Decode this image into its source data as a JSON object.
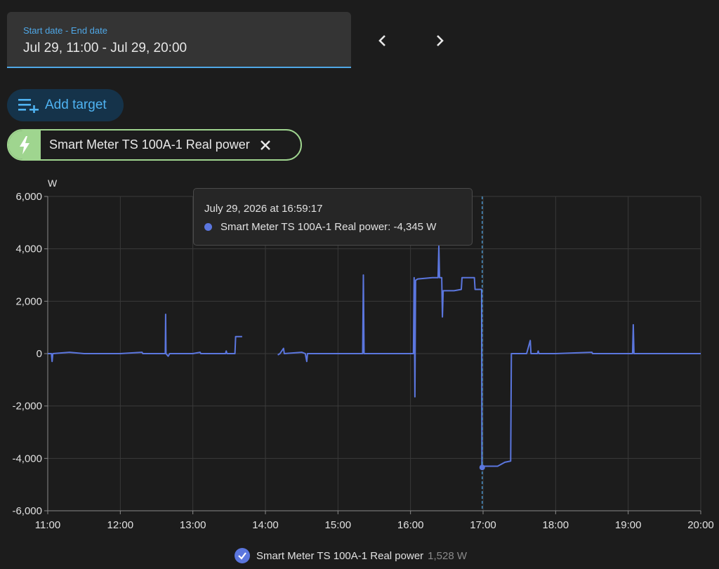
{
  "date_range": {
    "label": "Start date - End date",
    "value": "Jul 29, 11:00 - Jul 29, 20:00"
  },
  "nav": {
    "prev_icon": "chevron-left-icon",
    "next_icon": "chevron-right-icon"
  },
  "add_target": {
    "label": "Add target",
    "icon": "playlist-add-icon"
  },
  "target_chip": {
    "label": "Smart Meter TS 100A-1 Real power",
    "icon": "flash-icon",
    "close_icon": "close-icon"
  },
  "tooltip": {
    "date": "July 29, 2026 at 16:59:17",
    "text": "Smart Meter TS 100A-1 Real power: -4,345 W"
  },
  "legend": {
    "name": "Smart Meter TS 100A-1 Real power",
    "value": "1,528 W"
  },
  "colors": {
    "series": "#5b76de",
    "accent": "#4fa7e6",
    "chip": "#9fd58f"
  },
  "chart_data": {
    "type": "line",
    "ylabel": "W",
    "ylim": [
      -6000,
      6000
    ],
    "yticks": [
      "6,000",
      "4,000",
      "2,000",
      "0",
      "-2,000",
      "-4,000",
      "-6,000"
    ],
    "ytick_values": [
      6000,
      4000,
      2000,
      0,
      -2000,
      -4000,
      -6000
    ],
    "xlim": [
      11,
      20
    ],
    "xticks": [
      "11:00",
      "12:00",
      "13:00",
      "14:00",
      "15:00",
      "16:00",
      "17:00",
      "18:00",
      "19:00",
      "20:00"
    ],
    "xtick_values": [
      11,
      12,
      13,
      14,
      15,
      16,
      17,
      18,
      19,
      20
    ],
    "grid": true,
    "cursor_x": 16.988,
    "cursor_y": -4345,
    "series": [
      {
        "name": "Smart Meter TS 100A-1 Real power",
        "segments": [
          [
            [
              11.0,
              0
            ],
            [
              11.05,
              0
            ],
            [
              11.06,
              -300
            ],
            [
              11.07,
              0
            ],
            [
              11.3,
              50
            ],
            [
              11.5,
              0
            ],
            [
              12.0,
              0
            ],
            [
              12.3,
              50
            ],
            [
              12.31,
              0
            ],
            [
              12.62,
              0
            ],
            [
              12.625,
              1500
            ],
            [
              12.63,
              0
            ],
            [
              12.66,
              -100
            ],
            [
              12.68,
              0
            ],
            [
              13.0,
              0
            ],
            [
              13.1,
              50
            ],
            [
              13.11,
              0
            ],
            [
              13.45,
              0
            ],
            [
              13.46,
              100
            ],
            [
              13.47,
              0
            ],
            [
              13.58,
              0
            ],
            [
              13.59,
              650
            ],
            [
              13.68,
              650
            ]
          ],
          [
            [
              14.17,
              -50
            ],
            [
              14.2,
              0
            ],
            [
              14.25,
              200
            ],
            [
              14.26,
              0
            ],
            [
              14.5,
              50
            ],
            [
              14.55,
              0
            ],
            [
              14.57,
              -300
            ],
            [
              14.58,
              0
            ],
            [
              15.0,
              0
            ],
            [
              15.34,
              0
            ],
            [
              15.35,
              3000
            ],
            [
              15.36,
              0
            ],
            [
              15.6,
              0
            ],
            [
              16.0,
              0
            ],
            [
              16.04,
              0
            ],
            [
              16.05,
              2900
            ],
            [
              16.06,
              -1650
            ],
            [
              16.07,
              2800
            ],
            [
              16.1,
              2850
            ],
            [
              16.3,
              2900
            ],
            [
              16.38,
              2900
            ],
            [
              16.39,
              4100
            ],
            [
              16.4,
              2900
            ],
            [
              16.43,
              2900
            ],
            [
              16.44,
              1400
            ],
            [
              16.45,
              2400
            ],
            [
              16.6,
              2400
            ],
            [
              16.7,
              2450
            ],
            [
              16.71,
              2900
            ],
            [
              16.88,
              2900
            ],
            [
              16.89,
              2450
            ],
            [
              16.98,
              2450
            ],
            [
              16.985,
              -4345
            ],
            [
              17.0,
              -4300
            ],
            [
              17.2,
              -4300
            ],
            [
              17.3,
              -4150
            ],
            [
              17.38,
              -4100
            ],
            [
              17.39,
              0
            ],
            [
              17.6,
              0
            ],
            [
              17.65,
              500
            ],
            [
              17.66,
              0
            ],
            [
              17.75,
              0
            ],
            [
              17.76,
              100
            ],
            [
              17.77,
              0
            ],
            [
              18.0,
              0
            ],
            [
              18.5,
              50
            ],
            [
              18.51,
              0
            ],
            [
              19.0,
              0
            ],
            [
              19.06,
              0
            ],
            [
              19.07,
              1100
            ],
            [
              19.08,
              0
            ],
            [
              19.5,
              0
            ],
            [
              20.0,
              0
            ]
          ]
        ]
      }
    ]
  }
}
